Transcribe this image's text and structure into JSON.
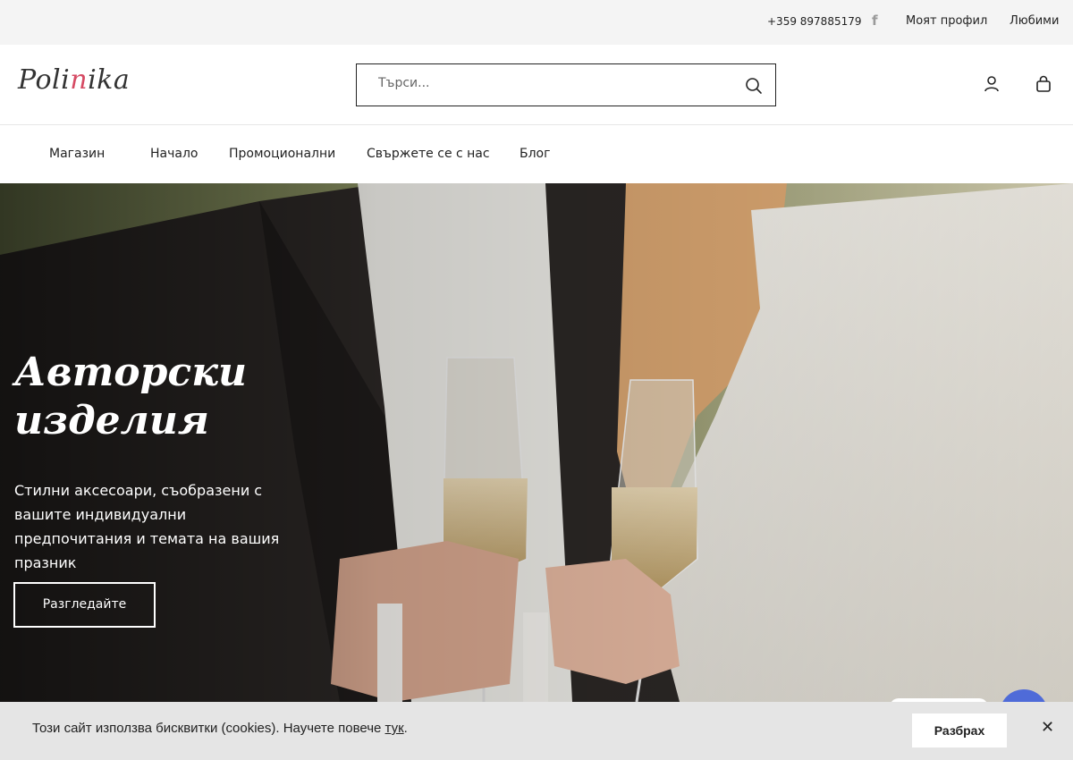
{
  "topbar": {
    "phone": "+359 897885179",
    "facebook_glyph": "f",
    "profile_label": "Моят профил",
    "favorites_label": "Любими"
  },
  "header": {
    "logo_text_a": "Poli",
    "logo_text_b": "n",
    "logo_text_c": "ika",
    "search_placeholder": "Търси...",
    "icons": [
      "search-icon",
      "user-icon",
      "bag-icon"
    ]
  },
  "nav": {
    "items": [
      "Магазин",
      "Начало",
      "Промоционални",
      "Свържете се с нас",
      "Блог"
    ]
  },
  "hero": {
    "title": "Авторски изделия",
    "text": "Стилни аксесоари, съобразени с вашите индивидуални предпочитания и темата на вашия празник",
    "button_label": "Разгледайте"
  },
  "cookie": {
    "message": "Този сайт използва бисквитки (cookies). Научете повече ",
    "link_text": "тук",
    "period": ".",
    "accept_label": "Разбрах",
    "close_glyph": "✕"
  },
  "colors": {
    "accent": "#d64a63",
    "chat": "#4f6bd8"
  }
}
